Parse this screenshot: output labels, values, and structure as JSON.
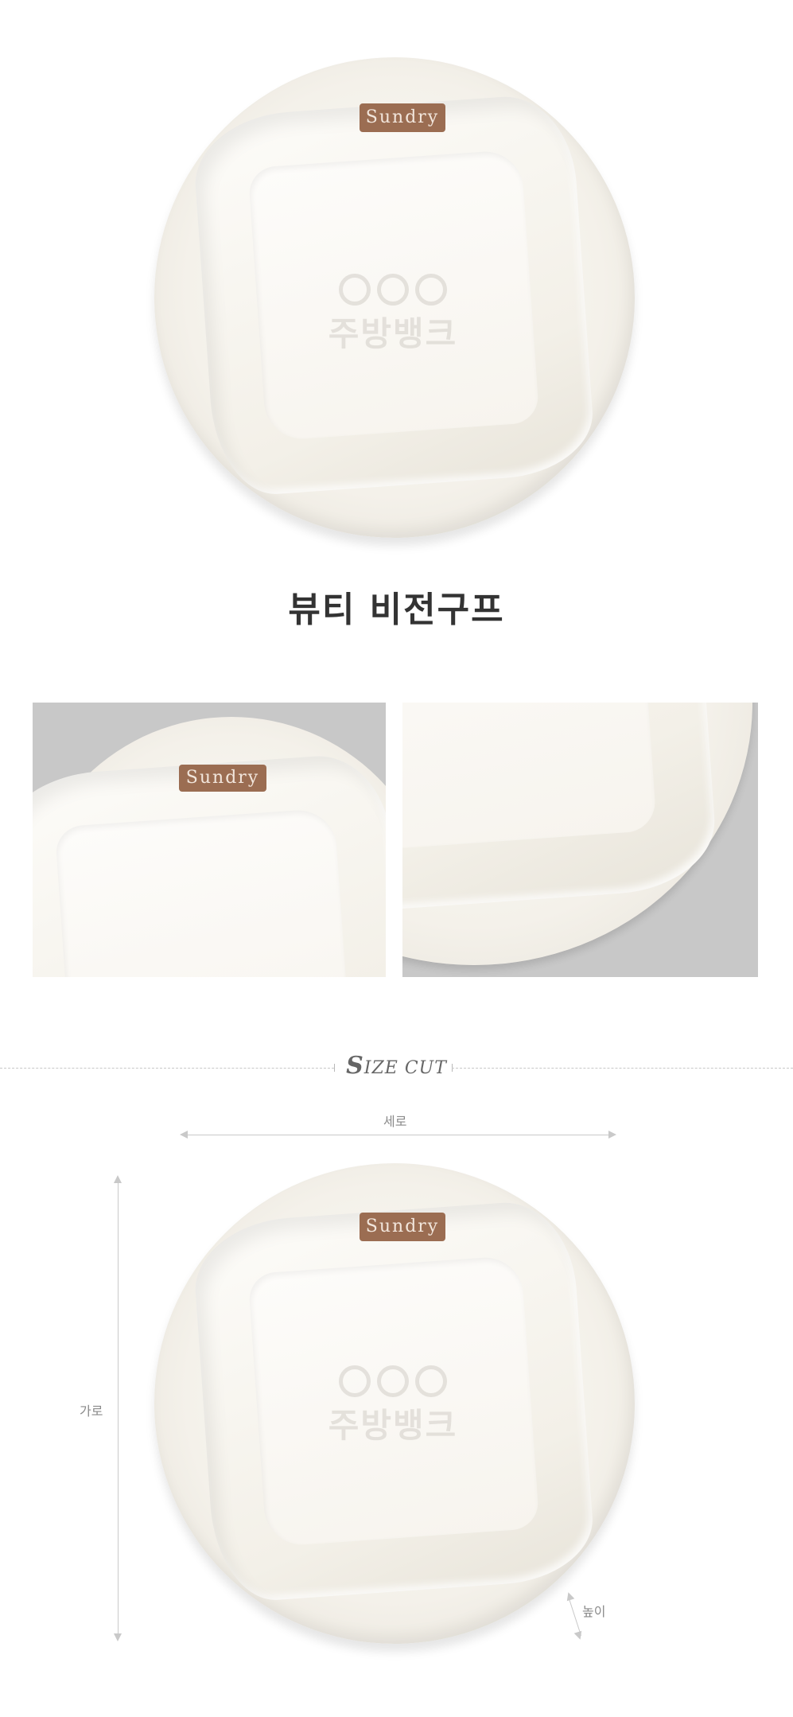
{
  "hero": {
    "brand_label": "Sundry",
    "watermark_text": "주방뱅크"
  },
  "product": {
    "title": "뷰티 비전구프"
  },
  "details": {
    "brand_label": "Sundry"
  },
  "size_section": {
    "heading_first": "S",
    "heading_rest": "IZE CUT",
    "width_label": "세로",
    "height_label": "가로",
    "depth_label": "높이",
    "brand_label": "Sundry",
    "watermark_text": "주방뱅크"
  },
  "colors": {
    "background": "#ffffff",
    "brand_badge": "#9b6d52",
    "title_text": "#333333",
    "photo_background": "#c8c8c8",
    "guide_lines": "#c9c9c9"
  }
}
